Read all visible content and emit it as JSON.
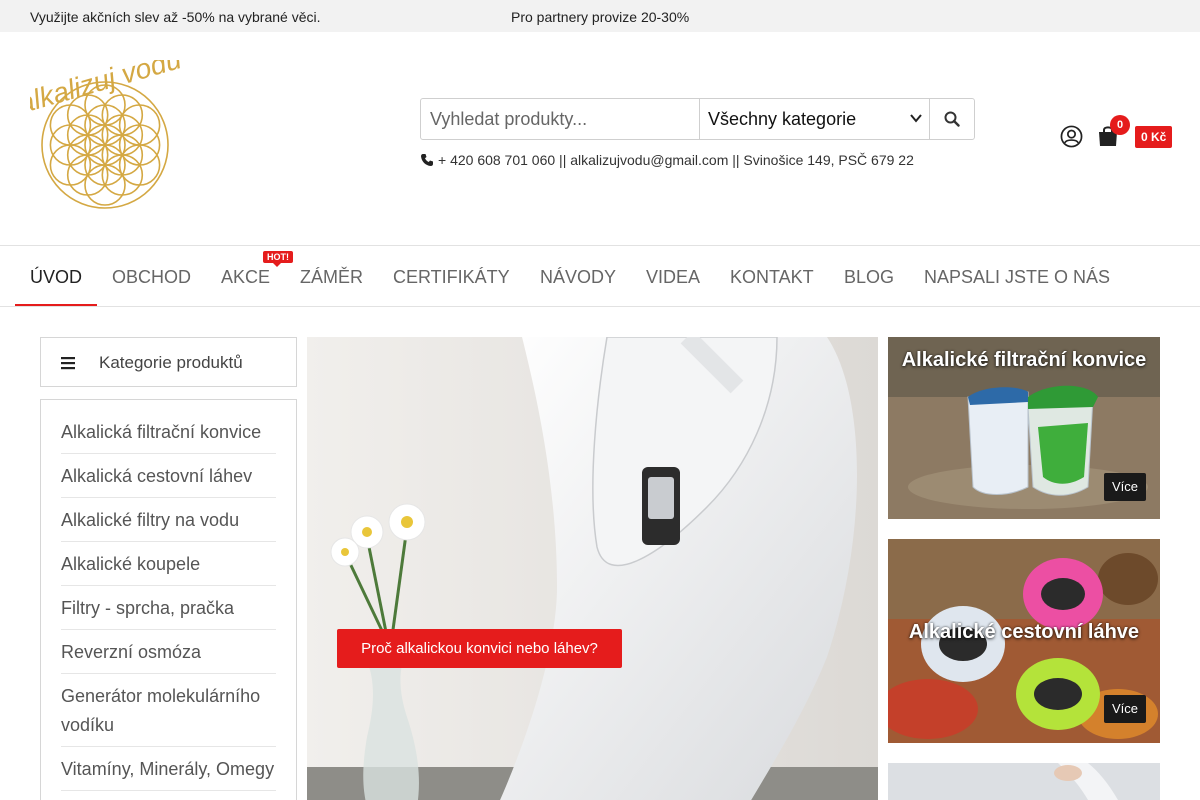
{
  "topbar": {
    "promo": "Využijte akčních slev až -50% na vybrané věci.",
    "partner": "Pro partnery provize 20-30%"
  },
  "logo": {
    "text": "alkalizuj vodu"
  },
  "search": {
    "placeholder": "Vyhledat produkty...",
    "category": "Všechny kategorie"
  },
  "contact": {
    "text": "+ 420 608 701 060 ||  alkalizujvodu@gmail.com || Svinošice 149, PSČ 679 22"
  },
  "cart": {
    "count": "0",
    "total": "0 Kč"
  },
  "nav": {
    "items": [
      "ÚVOD",
      "OBCHOD",
      "AKCE",
      "ZÁMĚR",
      "CERTIFIKÁTY",
      "NÁVODY",
      "VIDEA",
      "KONTAKT",
      "BLOG",
      "NAPSALI JSTE O NÁS"
    ],
    "hot": "HOT!"
  },
  "categories": {
    "title": "Kategorie produktů",
    "items": [
      "Alkalická filtrační konvice",
      "Alkalická cestovní láhev",
      "Alkalické filtry na vodu",
      "Alkalické koupele",
      "Filtry - sprcha, pračka",
      "Reverzní osmóza",
      "Generátor molekulárního vodíku",
      "Vitamíny, Minerály, Omegy"
    ]
  },
  "hero": {
    "button": "Proč alkalickou konvici nebo láhev?"
  },
  "banners": [
    {
      "title": "Alkalické filtrační konvice",
      "more": "Více"
    },
    {
      "title": "Alkalické cestovní láhve",
      "more": "Více"
    }
  ],
  "colors": {
    "accent": "#e51c1c",
    "logo_gold": "#d4a843"
  }
}
